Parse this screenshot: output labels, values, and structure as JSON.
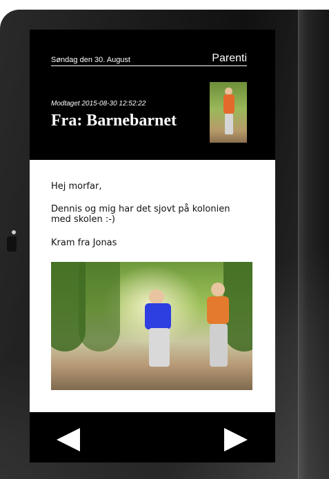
{
  "header": {
    "date": "Søndag den 30. August",
    "brand": "Parenti"
  },
  "message": {
    "received": "Modtaget 2015-08-30 12:52:22",
    "sender": "Fra: Barnebarnet",
    "body": [
      "Hej morfar,",
      "Dennis og mig har det sjovt på kolonien med skolen :-)",
      "Kram fra Jonas"
    ]
  },
  "navigation": {
    "previous_icon": "arrow-left-icon",
    "next_icon": "arrow-right-icon"
  },
  "colors": {
    "screen_background": "#000000",
    "message_background": "#ffffff",
    "text_on_dark": "#ffffff"
  }
}
